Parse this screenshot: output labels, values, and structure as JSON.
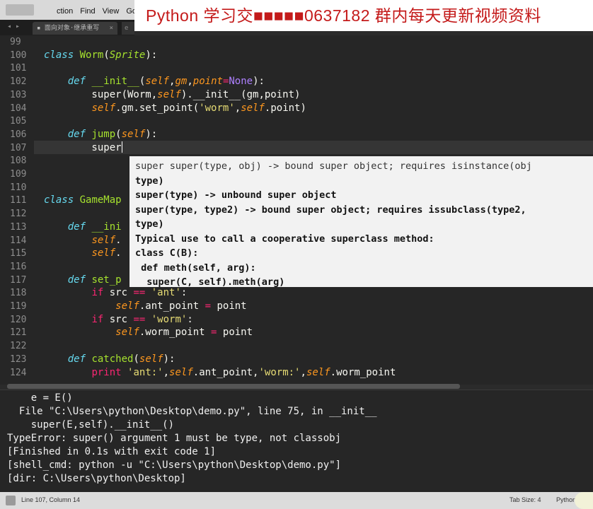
{
  "menubar": {
    "items": [
      "ction",
      "Find",
      "View",
      "Go"
    ]
  },
  "banner": {
    "text": "Python 学习交■■■■■0637182 群内每天更新视频资料"
  },
  "tabbar": {
    "nav": "◂ ▸",
    "tab_label": "▪ 面向对象·继承重写",
    "tab_close": "×",
    "tab2_label": "e"
  },
  "editor": {
    "line_numbers": [
      "99",
      "100",
      "101",
      "102",
      "103",
      "104",
      "105",
      "106",
      "107",
      "108",
      "109",
      "110",
      "111",
      "112",
      "113",
      "114",
      "115",
      "116",
      "117",
      "118",
      "119",
      "120",
      "121",
      "122",
      "123",
      "124"
    ],
    "current_line": "107"
  },
  "tooltip": {
    "lines": [
      "super super(type, obj) -> bound super object; requires isinstance(obj",
      "type)",
      "super(type) -> unbound super object",
      "super(type, type2) -> bound super object; requires issubclass(type2,",
      "type)",
      "Typical use to call a cooperative superclass method:",
      "class C(B):",
      " def meth(self, arg):",
      "  super(C, self).meth(arg)"
    ]
  },
  "console": {
    "lines": [
      "    e = E()",
      "  File \"C:\\Users\\python\\Desktop\\demo.py\", line 75, in __init__",
      "    super(E,self).__init__()",
      "TypeError: super() argument 1 must be type, not classobj",
      "[Finished in 0.1s with exit code 1]",
      "[shell_cmd: python -u \"C:\\Users\\python\\Desktop\\demo.py\"]",
      "[dir: C:\\Users\\python\\Desktop]"
    ]
  },
  "statusbar": {
    "position": "Line 107, Column 14",
    "tab_size": "Tab Size: 4",
    "syntax": "Python"
  },
  "colors": {
    "keyword": "#66d9ef",
    "class_name": "#a6e22e",
    "self": "#fd971f",
    "string": "#e6db74",
    "constant": "#ae81ff",
    "operator": "#f92672",
    "banner_text": "#c41a1a"
  }
}
